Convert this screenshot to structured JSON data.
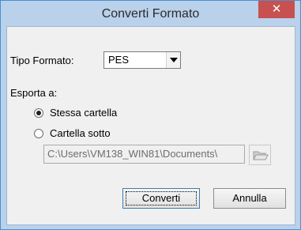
{
  "window": {
    "title": "Converti Formato",
    "close_icon": "close-icon"
  },
  "format": {
    "label": "Tipo Formato:",
    "selected": "PES"
  },
  "export": {
    "label": "Esporta a:",
    "options": [
      {
        "label": "Stessa cartella",
        "selected": true
      },
      {
        "label": "Cartella sotto",
        "selected": false
      }
    ],
    "path": "C:\\Users\\VM138_WIN81\\Documents\\",
    "browse_icon": "folder-open-icon"
  },
  "buttons": {
    "convert": "Converti",
    "cancel": "Annulla"
  },
  "colors": {
    "title_bar": "#b9d1ea",
    "close_button": "#c75050",
    "dialog_bg": "#f0f0f0"
  }
}
